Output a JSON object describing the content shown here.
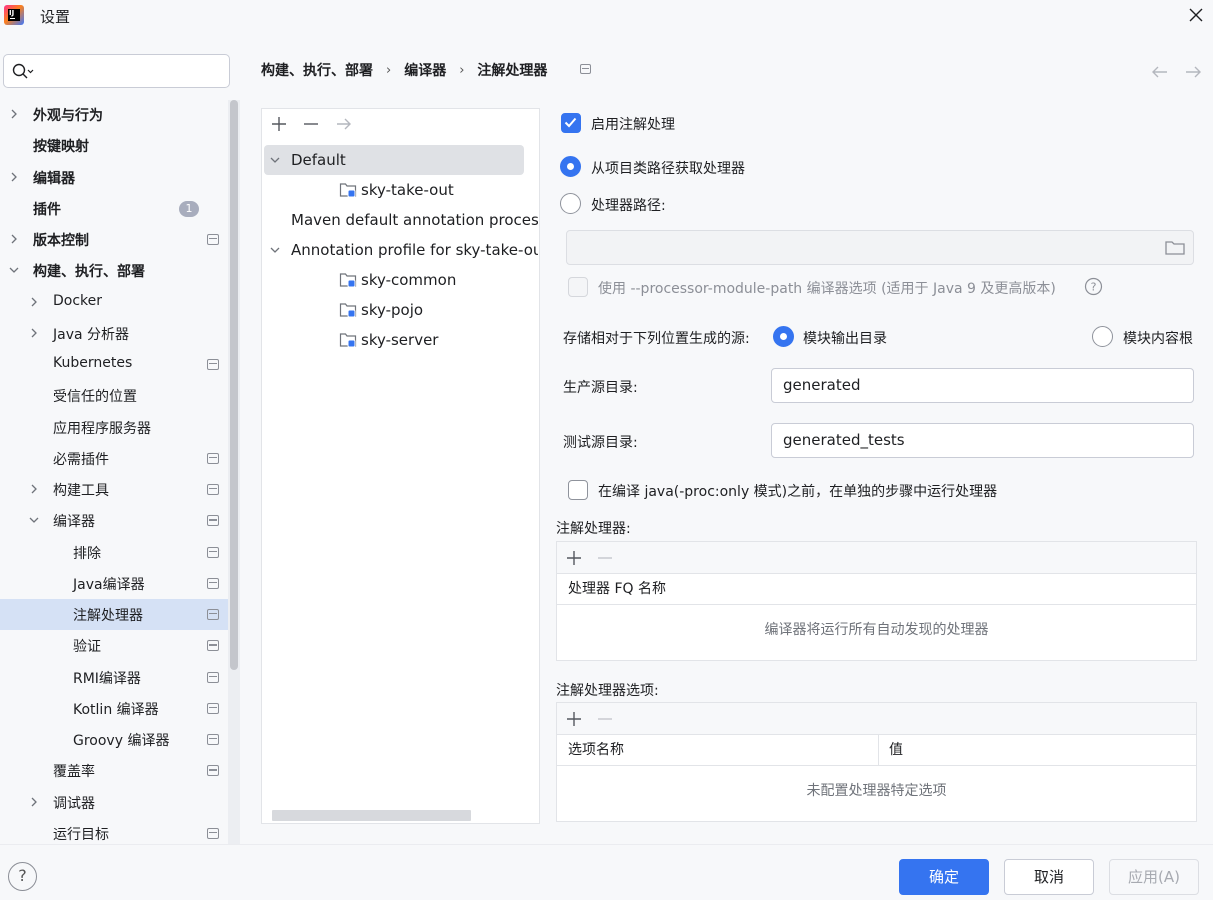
{
  "window": {
    "title": "设置"
  },
  "search": {
    "value": "",
    "placeholder": ""
  },
  "sidebar": {
    "items": [
      {
        "label": "外观与行为",
        "chevron": "right"
      },
      {
        "label": "按键映射"
      },
      {
        "label": "编辑器",
        "chevron": "right"
      },
      {
        "label": "插件",
        "badge": "1"
      },
      {
        "label": "版本控制",
        "chevron": "right"
      },
      {
        "label": "构建、执行、部署",
        "chevron": "down"
      },
      {
        "label": "Docker",
        "chevron": "right"
      },
      {
        "label": "Java 分析器",
        "chevron": "right"
      },
      {
        "label": "Kubernetes"
      },
      {
        "label": "受信任的位置"
      },
      {
        "label": "应用程序服务器"
      },
      {
        "label": "必需插件"
      },
      {
        "label": "构建工具",
        "chevron": "right"
      },
      {
        "label": "编译器",
        "chevron": "down"
      },
      {
        "label": "排除"
      },
      {
        "label": "Java编译器"
      },
      {
        "label": "注解处理器",
        "selected": true
      },
      {
        "label": "验证"
      },
      {
        "label": "RMI编译器"
      },
      {
        "label": "Kotlin 编译器"
      },
      {
        "label": "Groovy 编译器"
      },
      {
        "label": "覆盖率"
      },
      {
        "label": "调试器",
        "chevron": "right"
      },
      {
        "label": "运行目标"
      }
    ]
  },
  "breadcrumb": {
    "items": [
      "构建、执行、部署",
      "编译器",
      "注解处理器"
    ]
  },
  "profiles": {
    "tree": [
      {
        "label": "Default",
        "expanded": true,
        "selected": true
      },
      {
        "label": "sky-take-out",
        "module": true
      },
      {
        "label": "Maven default annotation processors profile"
      },
      {
        "label": "Annotation profile for sky-take-out",
        "expanded": true
      },
      {
        "label": "sky-common",
        "module": true
      },
      {
        "label": "sky-pojo",
        "module": true
      },
      {
        "label": "sky-server",
        "module": true
      }
    ]
  },
  "settings": {
    "enable_label": "启用注解处理",
    "enable_checked": true,
    "from_classpath_label": "从项目类路径获取处理器",
    "processor_path_label": "处理器路径:",
    "processor_path_value": "",
    "module_path_label": "使用 --processor-module-path 编译器选项 (适用于 Java 9 及更高版本)",
    "store_label": "存储相对于下列位置生成的源:",
    "module_output_label": "模块输出目录",
    "module_content_root_label": "模块内容根",
    "production_dir_label": "生产源目录:",
    "production_dir_value": "generated",
    "test_dir_label": "测试源目录:",
    "test_dir_value": "generated_tests",
    "separate_step_label": "在编译 java(-proc:only 模式)之前，在单独的步骤中运行处理器",
    "processors_title": "注解处理器:",
    "processors_col": "处理器 FQ 名称",
    "processors_empty": "编译器将运行所有自动发现的处理器",
    "options_title": "注解处理器选项:",
    "options_col_name": "选项名称",
    "options_col_value": "值",
    "options_empty": "未配置处理器特定选项"
  },
  "buttons": {
    "ok": "确定",
    "cancel": "取消",
    "apply": "应用(A)",
    "help": "?"
  },
  "colors": {
    "accent": "#3574f0",
    "selected_row": "#d5e1f5"
  }
}
